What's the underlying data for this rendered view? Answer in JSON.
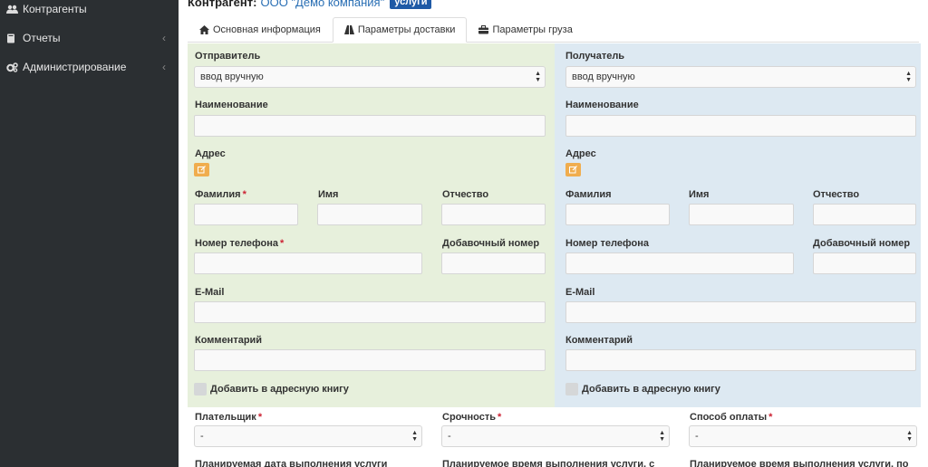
{
  "sidebar": {
    "items": [
      {
        "label": "Контрагенты",
        "icon": "users-icon"
      },
      {
        "label": "Отчеты",
        "icon": "book-icon",
        "chevron": "‹"
      },
      {
        "label": "Администрирование",
        "icon": "cogs-icon",
        "chevron": "‹"
      }
    ]
  },
  "header": {
    "label": "Контрагент:",
    "name": "ООО \"Демо компания\"",
    "badge": "услуги"
  },
  "tabs": [
    {
      "label": "Основная информация",
      "icon": "home-icon"
    },
    {
      "label": "Параметры доставки",
      "icon": "road-icon",
      "active": true
    },
    {
      "label": "Параметры груза",
      "icon": "briefcase-icon"
    }
  ],
  "sender": {
    "title": "Отправитель",
    "mode": "ввод вручную",
    "name_label": "Наименование",
    "address_label": "Адрес",
    "lastname_label": "Фамилия",
    "firstname_label": "Имя",
    "patronymic_label": "Отчество",
    "phone_label": "Номер телефона",
    "ext_label": "Добавочный номер",
    "email_label": "E-Mail",
    "comment_label": "Комментарий",
    "addressbook_label": "Добавить в адресную книгу",
    "required_mark": "*"
  },
  "recipient": {
    "title": "Получатель",
    "mode": "ввод вручную",
    "name_label": "Наименование",
    "address_label": "Адрес",
    "lastname_label": "Фамилия",
    "firstname_label": "Имя",
    "patronymic_label": "Отчество",
    "phone_label": "Номер телефона",
    "ext_label": "Добавочный номер",
    "email_label": "E-Mail",
    "comment_label": "Комментарий",
    "addressbook_label": "Добавить в адресную книгу"
  },
  "bottom": {
    "payer_label": "Плательщик",
    "urgency_label": "Срочность",
    "payment_label": "Способ оплаты",
    "placeholder": "-",
    "required_mark": "*",
    "date_label": "Планируемая дата выполнения услуги",
    "time_from_label": "Планируемое время выполнения услуги, с",
    "time_to_label": "Планируемое время выполнения услуги, по"
  },
  "colors": {
    "sidebar_bg": "#2b2f32",
    "sender_bg": "#e7f0dc",
    "recipient_bg": "#dde9f2",
    "badge_bg": "#1f5aa6",
    "edit_btn": "#f0ad4e",
    "required": "#cc2233"
  }
}
